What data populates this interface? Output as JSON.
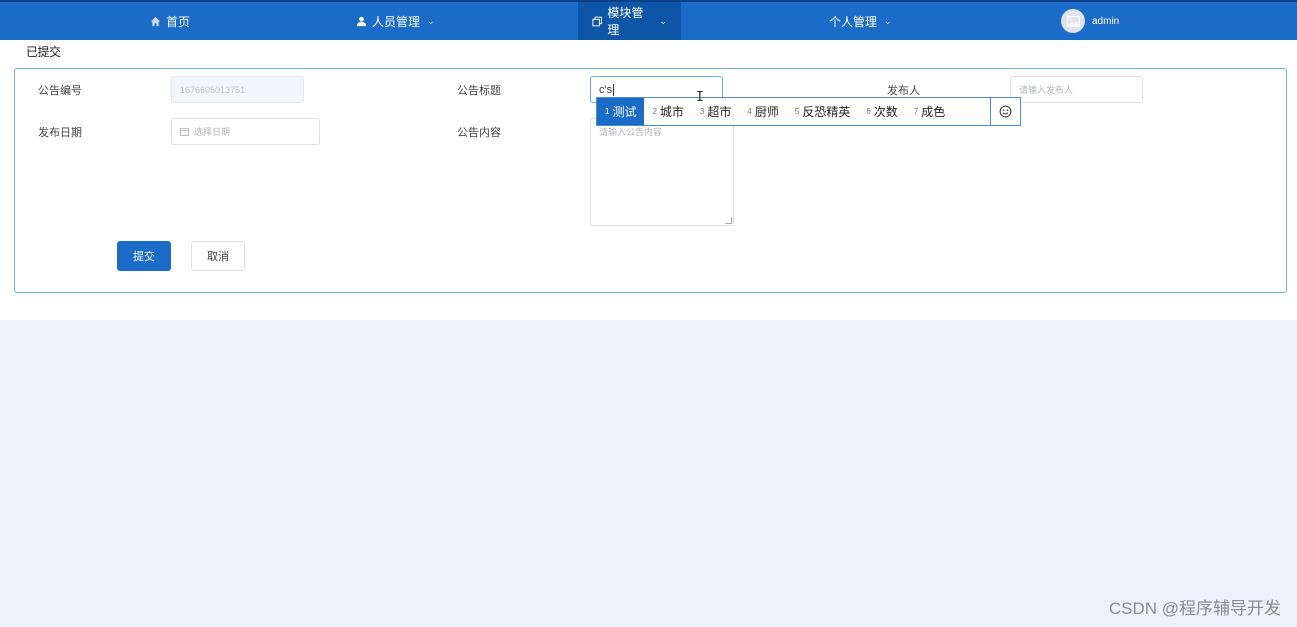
{
  "nav": {
    "home": "首页",
    "staff": "人员管理",
    "modules": "模块管理",
    "personal": "个人管理",
    "user": "admin"
  },
  "page": {
    "title": "已提交"
  },
  "form": {
    "notice_no_label": "公告编号",
    "notice_no_value": "1676605013751",
    "notice_title_label": "公告标题",
    "notice_title_value": "c's",
    "publisher_label": "发布人",
    "publisher_placeholder": "请输入发布人",
    "publish_date_label": "发布日期",
    "publish_date_placeholder": "选择日期",
    "content_label": "公告内容",
    "content_placeholder": "请输入公告内容",
    "submit": "提交",
    "cancel": "取消"
  },
  "ime": {
    "candidates": [
      {
        "num": "1",
        "text": "测试"
      },
      {
        "num": "2",
        "text": "城市"
      },
      {
        "num": "3",
        "text": "超市"
      },
      {
        "num": "4",
        "text": "厨师"
      },
      {
        "num": "5",
        "text": "反恐精英"
      },
      {
        "num": "6",
        "text": "次数"
      },
      {
        "num": "7",
        "text": "成色"
      }
    ],
    "selected_index": 0
  },
  "watermark": "CSDN @程序辅导开发",
  "colors": {
    "nav_bg": "#1a6cc8",
    "nav_active": "#0e55a8",
    "primary": "#1a6cc8",
    "page_bg": "#eef0fb",
    "card_border": "#6fb3dc"
  }
}
